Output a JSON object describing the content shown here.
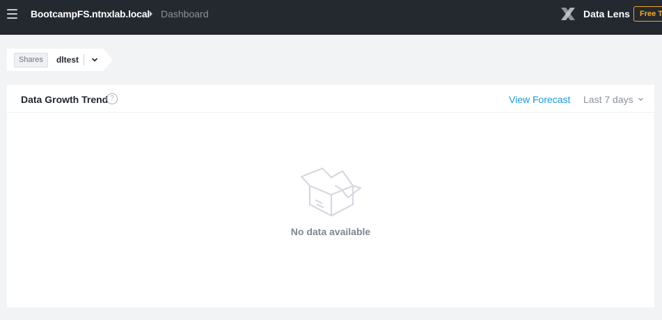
{
  "header": {
    "cluster_name": "BootcampFS.ntnxlab.local",
    "breadcrumb_current": "Dashboard",
    "product_name": "Data Lens",
    "trial_badge": "Free Trial",
    "menu_icon": "hamburger-menu-icon",
    "logo_icon": "nutanix-x-logo",
    "colors": {
      "background": "#24292f",
      "trial_accent": "#f5a623"
    }
  },
  "share_selector": {
    "tag_label": "Shares",
    "selected_value": "dltest",
    "caret_icon": "chevron-down-icon"
  },
  "panel": {
    "title": "Data Growth Trend",
    "help_icon": "question-circle-icon",
    "view_forecast_label": "View Forecast",
    "range_label": "Last 7 days",
    "range_caret_icon": "chevron-down-icon",
    "empty_state": {
      "icon": "empty-box-icon",
      "message": "No data available"
    },
    "colors": {
      "link": "#1b98e0",
      "muted": "#8a929e"
    }
  }
}
